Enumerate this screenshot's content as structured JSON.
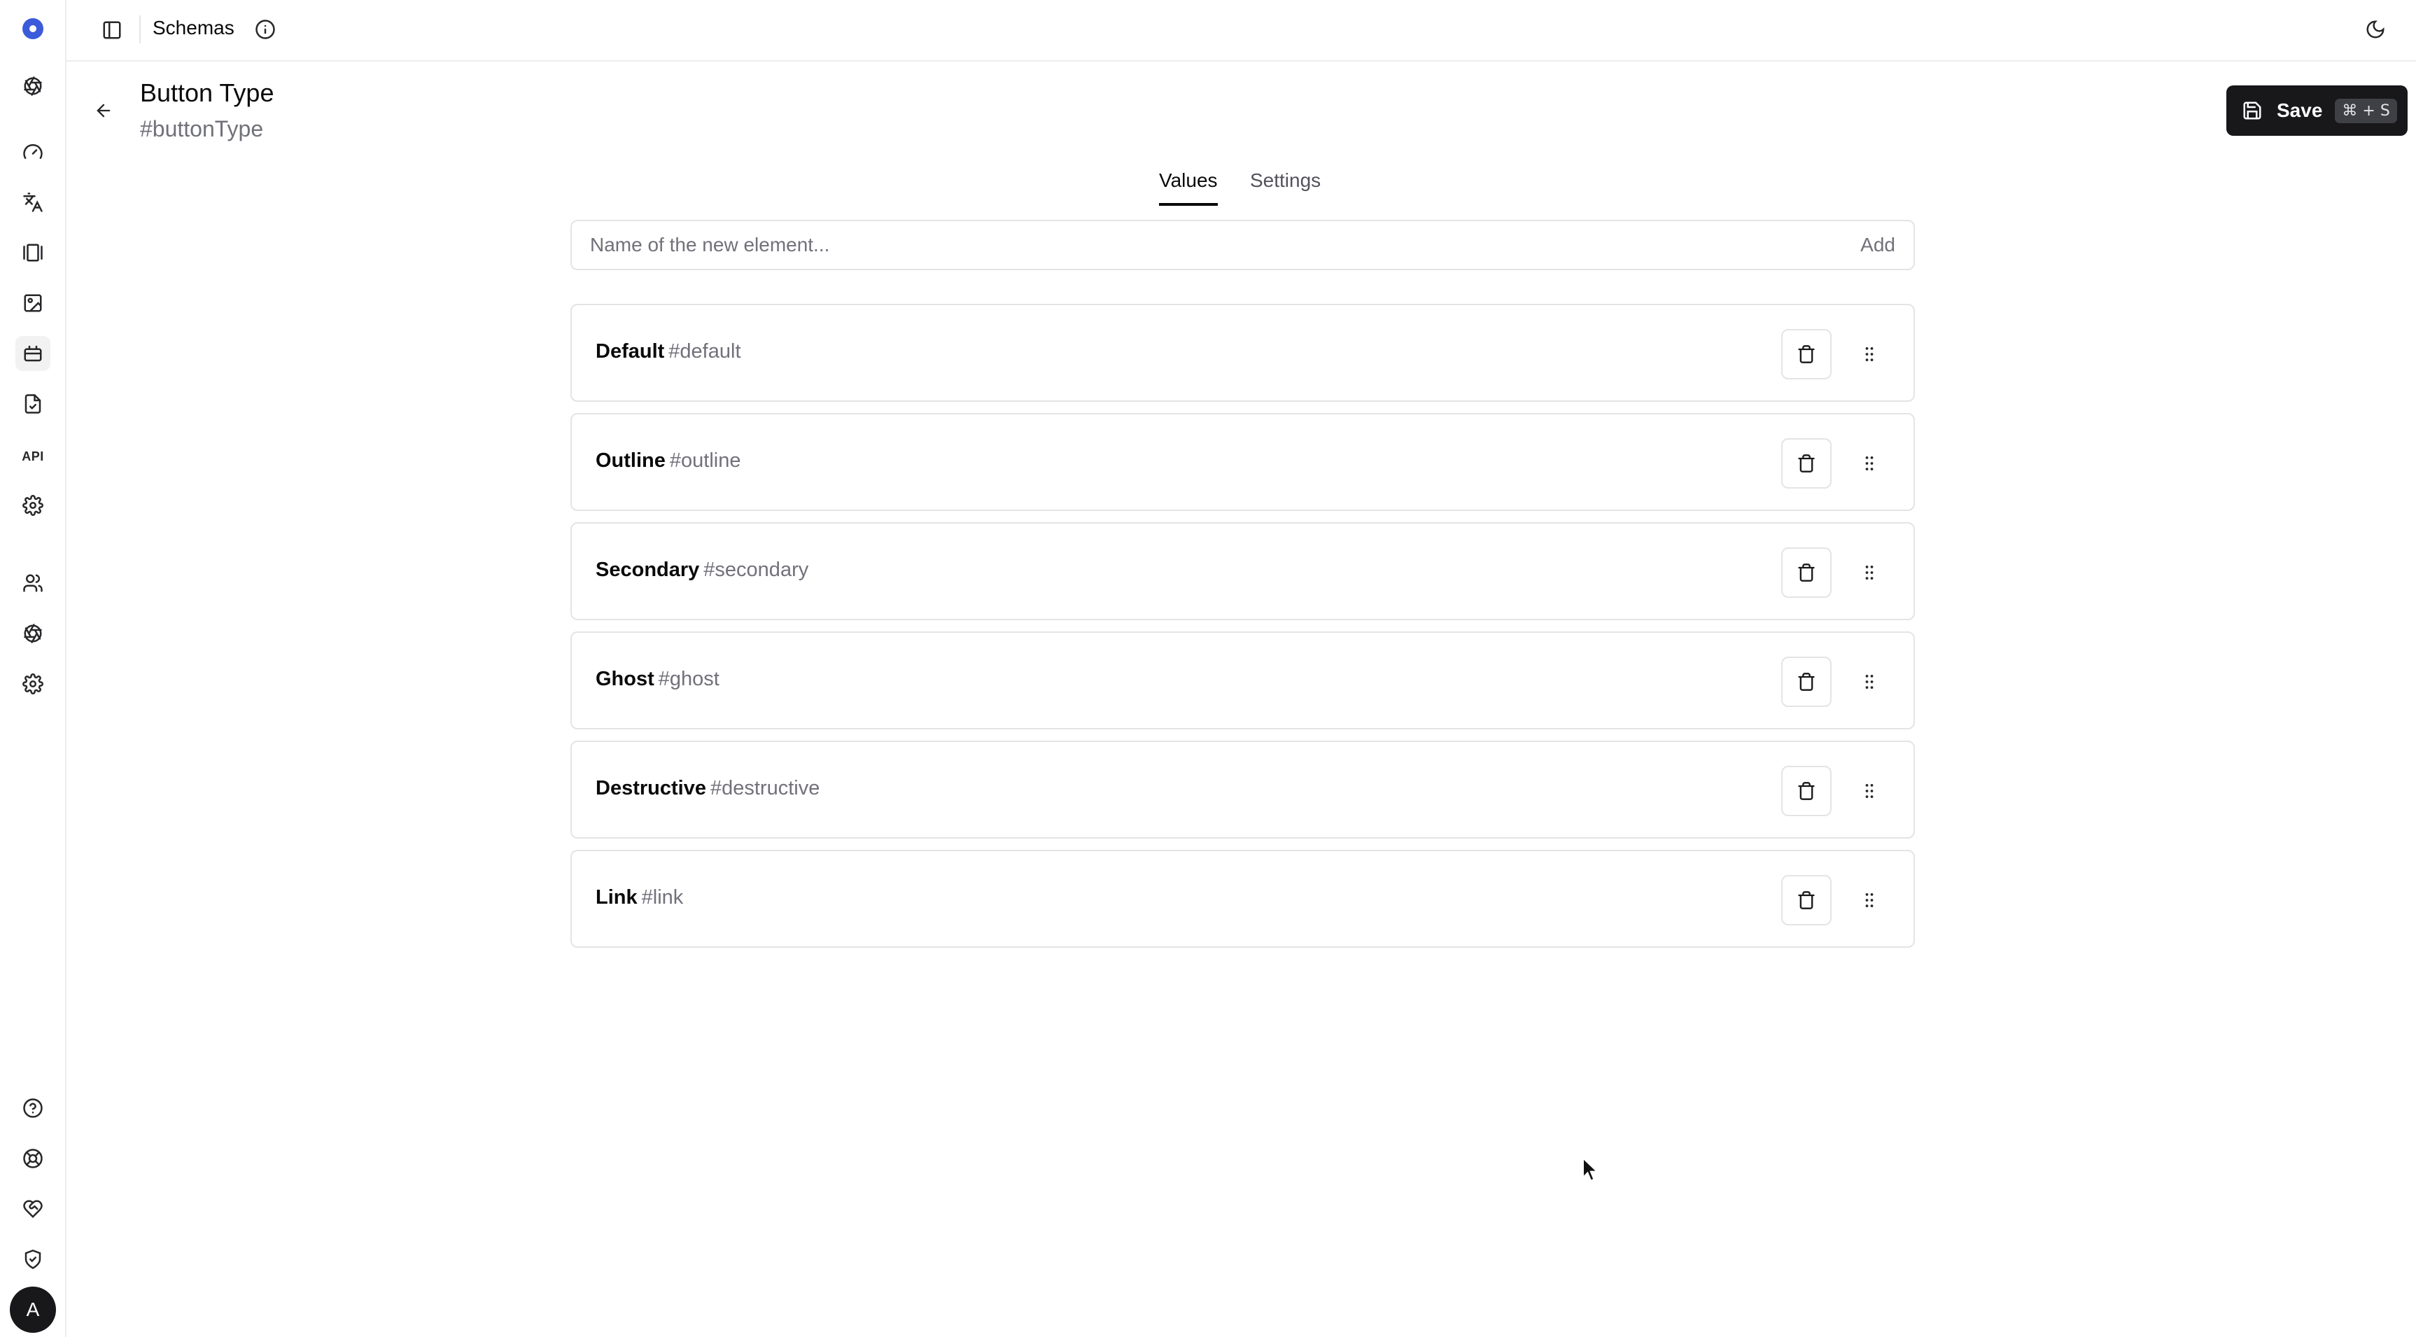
{
  "topbar": {
    "title": "Schemas"
  },
  "header": {
    "title": "Button Type",
    "subtitle": "#buttonType"
  },
  "save": {
    "label": "Save",
    "shortcut": "⌘ + S"
  },
  "tabs": [
    {
      "label": "Values"
    },
    {
      "label": "Settings"
    }
  ],
  "add": {
    "placeholder": "Name of the new element...",
    "button_label": "Add"
  },
  "values": [
    {
      "name": "Default",
      "slug": "#default"
    },
    {
      "name": "Outline",
      "slug": "#outline"
    },
    {
      "name": "Secondary",
      "slug": "#secondary"
    },
    {
      "name": "Ghost",
      "slug": "#ghost"
    },
    {
      "name": "Destructive",
      "slug": "#destructive"
    },
    {
      "name": "Link",
      "slug": "#link"
    }
  ],
  "sidebar": {
    "api_label": "API",
    "avatar_initial": "A"
  },
  "colors": {
    "brand": "#3b5bdb",
    "primary": "#18181b",
    "border": "#e4e4e7",
    "muted": "#71717a"
  }
}
